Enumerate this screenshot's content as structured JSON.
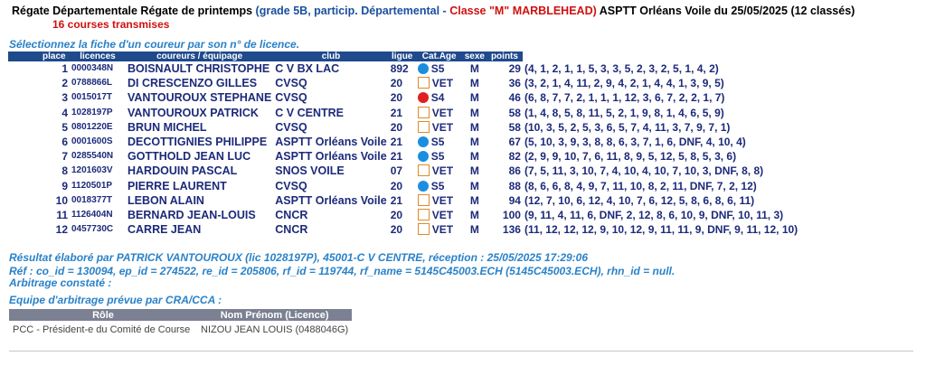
{
  "header": {
    "title_black": "Régate Départementale Régate de printemps",
    "title_blue": "(grade 5B, particip. Départemental - ",
    "title_red": "Classe \"M\" MARBLEHEAD)",
    "title_end": " ASPTT Orléans Voile du 25/05/2025 (12 classés)",
    "subtitle": "16 courses transmises"
  },
  "select_note": "Sélectionnez la fiche d'un coureur par son n° de licence.",
  "columns": [
    "place",
    "licences",
    "coureurs / équipage",
    "club",
    "ligue",
    "Cat.Age",
    "sexe",
    "points"
  ],
  "cat_colors": {
    "S5": "#1c8ee0",
    "S4": "#e02020"
  },
  "rows": [
    {
      "place": "1",
      "licence": "0000348N",
      "name": "BOISNAULT CHRISTOPHE",
      "club": "C V BX LAC",
      "ligue": "892",
      "cat": "S5",
      "cat_icon": "dot",
      "sexe": "M",
      "points": "29",
      "detail": "(4, 1, 2, 1, 1, 5, 3, 3, 5, 2, 3, 2, 5, 1, 4, 2)"
    },
    {
      "place": "2",
      "licence": "0788866L",
      "name": "DI CRESCENZO GILLES",
      "club": "CVSQ",
      "ligue": "20",
      "cat": "VET",
      "cat_icon": "box",
      "sexe": "M",
      "points": "36",
      "detail": "(3, 2, 1, 4, 11, 2, 9, 4, 2, 1, 4, 4, 1, 3, 9, 5)"
    },
    {
      "place": "3",
      "licence": "0015017T",
      "name": "VANTOUROUX STEPHANE",
      "club": "CVSQ",
      "ligue": "20",
      "cat": "S4",
      "cat_icon": "dot",
      "sexe": "M",
      "points": "46",
      "detail": "(6, 8, 7, 7, 2, 1, 1, 1, 12, 3, 6, 7, 2, 2, 1, 7)"
    },
    {
      "place": "4",
      "licence": "1028197P",
      "name": "VANTOUROUX PATRICK",
      "club": "C V CENTRE",
      "ligue": "21",
      "cat": "VET",
      "cat_icon": "box",
      "sexe": "M",
      "points": "58",
      "detail": "(1, 4, 8, 5, 8, 11, 5, 2, 1, 9, 8, 1, 4, 6, 5, 9)"
    },
    {
      "place": "5",
      "licence": "0801220E",
      "name": "BRUN MICHEL",
      "club": "CVSQ",
      "ligue": "20",
      "cat": "VET",
      "cat_icon": "box",
      "sexe": "M",
      "points": "58",
      "detail": "(10, 3, 5, 2, 5, 3, 6, 5, 7, 4, 11, 3, 7, 9, 7, 1)"
    },
    {
      "place": "6",
      "licence": "0001600S",
      "name": "DECOTTIGNIES PHILIPPE",
      "club": "ASPTT Orléans Voile",
      "ligue": "21",
      "cat": "S5",
      "cat_icon": "dot",
      "sexe": "M",
      "points": "67",
      "detail": "(5, 10, 3, 9, 3, 8, 8, 6, 3, 7, 1, 6, DNF, 4, 10, 4)"
    },
    {
      "place": "7",
      "licence": "0285540N",
      "name": "GOTTHOLD JEAN LUC",
      "club": "ASPTT Orléans Voile",
      "ligue": "21",
      "cat": "S5",
      "cat_icon": "dot",
      "sexe": "M",
      "points": "82",
      "detail": "(2, 9, 9, 10, 7, 6, 11, 8, 9, 5, 12, 5, 8, 5, 3, 6)"
    },
    {
      "place": "8",
      "licence": "1201603V",
      "name": "HARDOUIN PASCAL",
      "club": "SNOS VOILE",
      "ligue": "07",
      "cat": "VET",
      "cat_icon": "box",
      "sexe": "M",
      "points": "86",
      "detail": "(7, 5, 11, 3, 10, 7, 4, 10, 4, 10, 7, 10, 3, DNF, 8, 8)"
    },
    {
      "place": "9",
      "licence": "1120501P",
      "name": "PIERRE LAURENT",
      "club": "CVSQ",
      "ligue": "20",
      "cat": "S5",
      "cat_icon": "dot",
      "sexe": "M",
      "points": "88",
      "detail": "(8, 6, 6, 8, 4, 9, 7, 11, 10, 8, 2, 11, DNF, 7, 2, 12)"
    },
    {
      "place": "10",
      "licence": "0018377T",
      "name": "LEBON ALAIN",
      "club": "ASPTT Orléans Voile",
      "ligue": "21",
      "cat": "VET",
      "cat_icon": "box",
      "sexe": "M",
      "points": "94",
      "detail": "(12, 7, 10, 6, 12, 4, 10, 7, 6, 12, 5, 8, 6, 8, 6, 11)"
    },
    {
      "place": "11",
      "licence": "1126404N",
      "name": "BERNARD JEAN-LOUIS",
      "club": "CNCR",
      "ligue": "20",
      "cat": "VET",
      "cat_icon": "box",
      "sexe": "M",
      "points": "100",
      "detail": "(9, 11, 4, 11, 6, DNF, 2, 12, 8, 6, 10, 9, DNF, 10, 11, 3)"
    },
    {
      "place": "12",
      "licence": "0457730C",
      "name": "CARRE JEAN",
      "club": "CNCR",
      "ligue": "20",
      "cat": "VET",
      "cat_icon": "box",
      "sexe": "M",
      "points": "136",
      "detail": "(11, 12, 12, 12, 9, 10, 12, 9, 11, 11, 9, DNF, 9, 11, 12, 10)"
    }
  ],
  "footer": {
    "result_line": "Résultat élaboré par PATRICK VANTOUROUX (lic 1028197P), 45001-C V CENTRE, réception : 25/05/2025 17:29:06",
    "ref_line": "Réf : co_id = 130094, ep_id = 274522, re_id = 205806, rf_id = 119744, rf_name = 5145C45003.ECH (5145C45003.ECH), rhn_id = null.",
    "arbitrage_constate": "Arbitrage constaté :",
    "equipe_prevue": "Equipe d'arbitrage prévue par CRA/CCA :"
  },
  "arbitrage": {
    "columns": [
      "Rôle",
      "Nom Prénom (Licence)"
    ],
    "rows": [
      {
        "role": "PCC - Président-e du Comité de Course",
        "name": "NIZOU JEAN LOUIS (0488046G)"
      }
    ]
  }
}
